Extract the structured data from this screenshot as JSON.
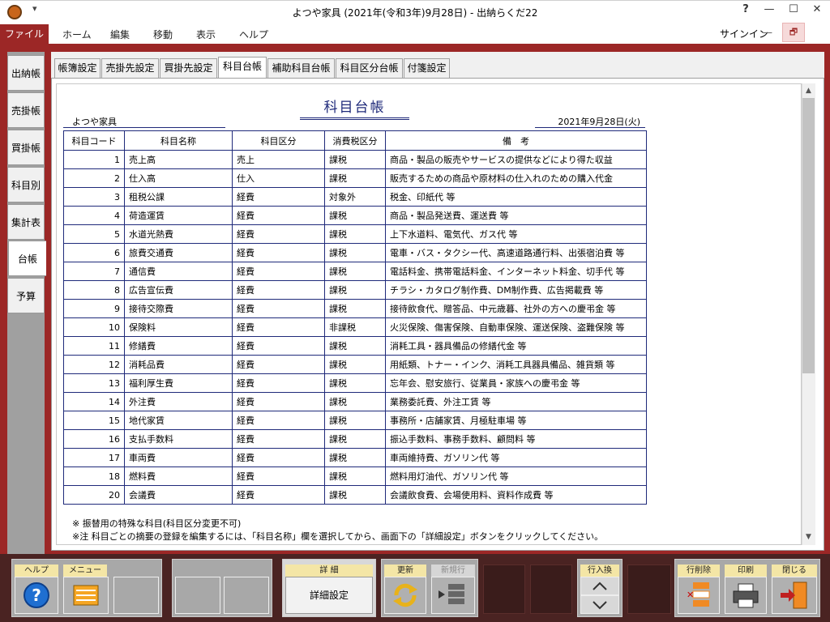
{
  "window": {
    "title": "よつや家具 (2021年(令和3年)9月28日) - 出納らくだ22",
    "help_glyph": "?",
    "minimize_glyph": "—",
    "maximize_glyph": "☐",
    "close_glyph": "✕",
    "quick_access": "▾"
  },
  "menu": {
    "file": "ファイル",
    "items": [
      "ホーム",
      "編集",
      "移動",
      "表示",
      "ヘルプ"
    ],
    "signin": "サインイン",
    "ribbon_min": "—",
    "ribbon_restore": "🗗"
  },
  "side_tabs": [
    "出納帳",
    "売掛帳",
    "買掛帳",
    "科目別",
    "集計表",
    "台帳",
    "予算"
  ],
  "top_tabs": [
    "帳簿設定",
    "売掛先設定",
    "買掛先設定",
    "科目台帳",
    "補助科目台帳",
    "科目区分台帳",
    "付箋設定"
  ],
  "document": {
    "title": "科目台帳",
    "company": "よつや家具",
    "date": "2021年9月28日(火)",
    "headers": [
      "科目コード",
      "科目名称",
      "科目区分",
      "消費税区分",
      "備　考"
    ],
    "rows": [
      [
        "1",
        "売上高",
        "売上",
        "課税",
        "商品・製品の販売やサービスの提供などにより得た収益"
      ],
      [
        "2",
        "仕入高",
        "仕入",
        "課税",
        "販売するための商品や原材料の仕入れのための購入代金"
      ],
      [
        "3",
        "租税公課",
        "経費",
        "対象外",
        "税金、印紙代 等"
      ],
      [
        "4",
        "荷造運賃",
        "経費",
        "課税",
        "商品・製品発送費、運送費 等"
      ],
      [
        "5",
        "水道光熱費",
        "経費",
        "課税",
        "上下水道料、電気代、ガス代 等"
      ],
      [
        "6",
        "旅費交通費",
        "経費",
        "課税",
        "電車・バス・タクシー代、高速道路通行料、出張宿泊費 等"
      ],
      [
        "7",
        "通信費",
        "経費",
        "課税",
        "電話料金、携帯電話料金、インターネット料金、切手代 等"
      ],
      [
        "8",
        "広告宣伝費",
        "経費",
        "課税",
        "チラシ・カタログ制作費、DM制作費、広告掲載費 等"
      ],
      [
        "9",
        "接待交際費",
        "経費",
        "課税",
        "接待飲食代、贈答品、中元歳暮、社外の方への慶弔金 等"
      ],
      [
        "10",
        "保険料",
        "経費",
        "非課税",
        "火災保険、傷害保険、自動車保険、運送保険、盗難保険 等"
      ],
      [
        "11",
        "修繕費",
        "経費",
        "課税",
        "消耗工具・器具備品の修繕代金 等"
      ],
      [
        "12",
        "消耗品費",
        "経費",
        "課税",
        "用紙類、トナー・インク、消耗工具器具備品、雑貨類 等"
      ],
      [
        "13",
        "福利厚生費",
        "経費",
        "課税",
        "忘年会、慰安旅行、従業員・家族への慶弔金 等"
      ],
      [
        "14",
        "外注費",
        "経費",
        "課税",
        "業務委託費、外注工賃 等"
      ],
      [
        "15",
        "地代家賃",
        "経費",
        "課税",
        "事務所・店舗家賃、月極駐車場 等"
      ],
      [
        "16",
        "支払手数料",
        "経費",
        "課税",
        "振込手数料、事務手数料、顧問料 等"
      ],
      [
        "17",
        "車両費",
        "経費",
        "課税",
        "車両維持費、ガソリン代 等"
      ],
      [
        "18",
        "燃料費",
        "経費",
        "課税",
        "燃料用灯油代、ガソリン代 等"
      ],
      [
        "20",
        "会議費",
        "経費",
        "課税",
        "会議飲食費、会場使用料、資料作成費 等"
      ]
    ],
    "notes": [
      "※ 振替用の特殊な科目(科目区分変更不可)",
      "※注 科目ごとの摘要の登録を編集するには、「科目名称」欄を選択してから、画面下の「詳細設定」ボタンをクリックしてください。"
    ]
  },
  "toolbar": {
    "help": "ヘルプ",
    "menu": "メニュー",
    "detail_label": "詳 細",
    "detail_button": "詳細設定",
    "update": "更新",
    "new_line": "新規行",
    "row_swap": "行入換",
    "row_delete": "行削除",
    "print": "印刷",
    "close": "閉じる"
  }
}
